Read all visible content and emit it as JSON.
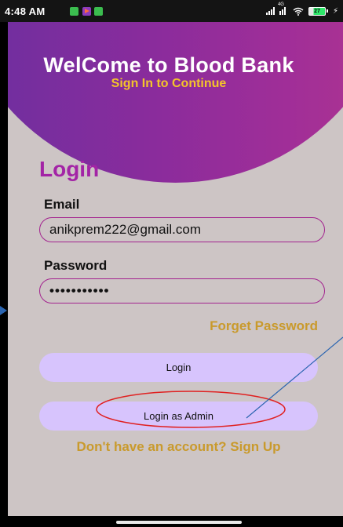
{
  "status_bar": {
    "time": "4:48 AM",
    "network_tag": "4G",
    "battery": "27"
  },
  "header": {
    "title": "WelCome to Blood Bank",
    "subtitle": "Sign In to Continue"
  },
  "form": {
    "title": "Login",
    "email_label": "Email",
    "email_value": "anikprem222@gmail.com",
    "password_label": "Password",
    "password_value": "•••••••••••",
    "forget_password": "Forget Password",
    "login_button": "Login",
    "admin_button": "Login as Admin",
    "signup_link": "Don't have an account? Sign Up"
  },
  "colors": {
    "header_gradient_start": "#6a2fa0",
    "header_gradient_end": "#b0358f",
    "subtitle": "#f4c52a",
    "login_title": "#a324a6",
    "field_border": "#a3238f",
    "link": "#c99a2c",
    "button_bg": "#d7c4fd",
    "background": "#cdc5c5",
    "annotation_ellipse": "#e02020",
    "annotation_arrow": "#2a64b0"
  }
}
